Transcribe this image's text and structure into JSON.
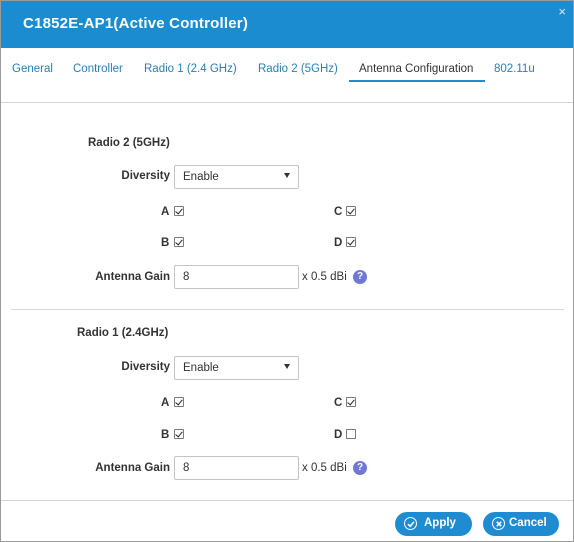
{
  "window": {
    "title": "C1852E-AP1(Active Controller)",
    "close_glyph": "×"
  },
  "tabs": [
    {
      "label": "General"
    },
    {
      "label": "Controller"
    },
    {
      "label": "Radio 1 (2.4 GHz)"
    },
    {
      "label": "Radio 2 (5GHz)"
    },
    {
      "label": "Antenna Configuration",
      "active": true
    },
    {
      "label": "802.11u"
    }
  ],
  "radio2": {
    "title": "Radio 2 (5GHz)",
    "diversity_label": "Diversity",
    "diversity_value": "Enable",
    "antennas": [
      {
        "label": "A",
        "checked": true
      },
      {
        "label": "B",
        "checked": true
      },
      {
        "label": "C",
        "checked": true
      },
      {
        "label": "D",
        "checked": true
      }
    ],
    "gain_label": "Antenna Gain",
    "gain_value": "8",
    "gain_unit": "x 0.5 dBi"
  },
  "radio1": {
    "title": "Radio 1 (2.4GHz)",
    "diversity_label": "Diversity",
    "diversity_value": "Enable",
    "antennas": [
      {
        "label": "A",
        "checked": true
      },
      {
        "label": "B",
        "checked": true
      },
      {
        "label": "C",
        "checked": true
      },
      {
        "label": "D",
        "checked": false
      }
    ],
    "gain_label": "Antenna Gain",
    "gain_value": "8",
    "gain_unit": "x 0.5 dBi"
  },
  "help_glyph": "?",
  "footer": {
    "apply_label": "Apply",
    "cancel_label": "Cancel"
  },
  "colors": {
    "header": "#1a8ccf",
    "accent": "#1f8bd0",
    "link": "#2a7fb3",
    "help": "#6f78d6"
  }
}
